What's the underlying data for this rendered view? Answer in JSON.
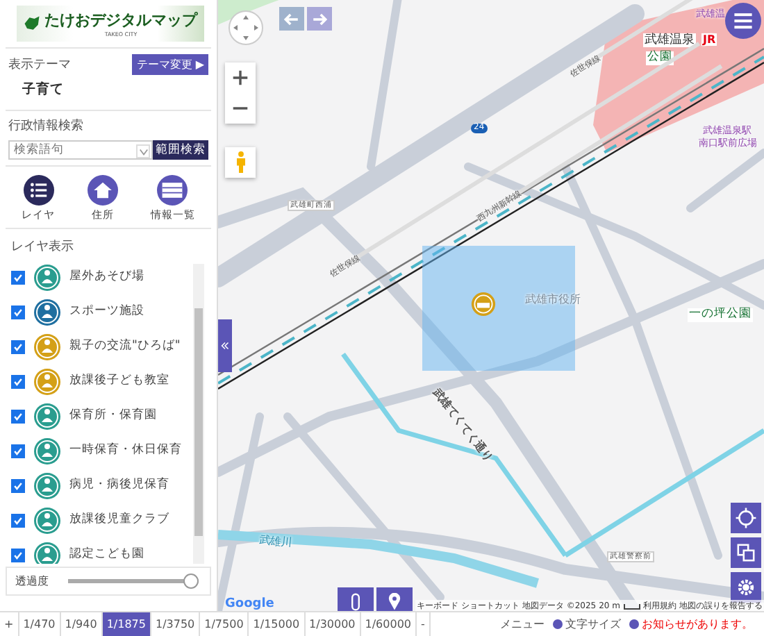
{
  "logo": {
    "title": "たけおデジタルマップ",
    "subtitle": "TAKEO CITY"
  },
  "theme": {
    "label": "表示テーマ",
    "button": "テーマ変更 ▶",
    "value": "子育て"
  },
  "search": {
    "label": "行政情報検索",
    "placeholder": "検索語句",
    "button": "範囲検索"
  },
  "tool_buttons": [
    {
      "kind": "list",
      "label": "レイヤ",
      "selected": true
    },
    {
      "kind": "home",
      "label": "住所",
      "selected": false
    },
    {
      "kind": "table",
      "label": "情報一覧",
      "selected": false
    }
  ],
  "layers": {
    "title": "レイヤ表示",
    "items": [
      {
        "label": "屋外あそび場",
        "checked": true,
        "color": "#2a9d8f"
      },
      {
        "label": "スポーツ施設",
        "checked": true,
        "color": "#1f6fa0"
      },
      {
        "label": "親子の交流\"ひろば\"",
        "checked": true,
        "color": "#d4a017"
      },
      {
        "label": "放課後子ども教室",
        "checked": true,
        "color": "#d4a017"
      },
      {
        "label": "保育所・保育園",
        "checked": true,
        "color": "#2a9d8f"
      },
      {
        "label": "一時保育・休日保育",
        "checked": true,
        "color": "#2a9d8f"
      },
      {
        "label": "病児・病後児保育",
        "checked": true,
        "color": "#2a9d8f"
      },
      {
        "label": "放課後児童クラブ",
        "checked": true,
        "color": "#2a9d8f"
      },
      {
        "label": "認定こども園",
        "checked": true,
        "color": "#2a9d8f"
      }
    ]
  },
  "opacity": {
    "label": "透過度",
    "level": 1.0
  },
  "map": {
    "labels": [
      {
        "text": "武雄温",
        "kind": "poi"
      },
      {
        "text": "武雄温泉",
        "kind": "station"
      },
      {
        "text": "JR",
        "kind": "jr"
      },
      {
        "text": "公園",
        "kind": "park"
      },
      {
        "text": "佐世保線",
        "kind": "rail"
      },
      {
        "text": "24",
        "kind": "route"
      },
      {
        "text": "武雄温泉駅",
        "kind": "poi"
      },
      {
        "text": "南口駅前広場",
        "kind": "poi"
      },
      {
        "text": "武雄町西浦",
        "kind": "stop"
      },
      {
        "text": "佐世保線",
        "kind": "rail"
      },
      {
        "text": "西九州新幹線",
        "kind": "rail"
      },
      {
        "text": "武雄市役所",
        "kind": "place"
      },
      {
        "text": "一の坪公園",
        "kind": "park"
      },
      {
        "text": "武雄てくてく通り",
        "kind": "street"
      },
      {
        "text": "武雄川",
        "kind": "river"
      },
      {
        "text": "武雄警察前",
        "kind": "stop"
      }
    ],
    "attribution": {
      "google": "Google",
      "shortcuts": "キーボード ショートカット",
      "data": "地図データ ©2025",
      "scale": "20 m",
      "terms": "利用規約",
      "report": "地図の誤りを報告する"
    }
  },
  "scales": [
    {
      "label": "+",
      "selected": false
    },
    {
      "label": "1/470",
      "selected": false
    },
    {
      "label": "1/940",
      "selected": false
    },
    {
      "label": "1/1875",
      "selected": true
    },
    {
      "label": "1/3750",
      "selected": false
    },
    {
      "label": "1/7500",
      "selected": false
    },
    {
      "label": "1/15000",
      "selected": false
    },
    {
      "label": "1/30000",
      "selected": false
    },
    {
      "label": "1/60000",
      "selected": false
    },
    {
      "label": "-",
      "selected": false
    }
  ],
  "footer": {
    "menu": "メニュー",
    "font_size": "文字サイズ",
    "notice": "お知らせがあります。"
  }
}
